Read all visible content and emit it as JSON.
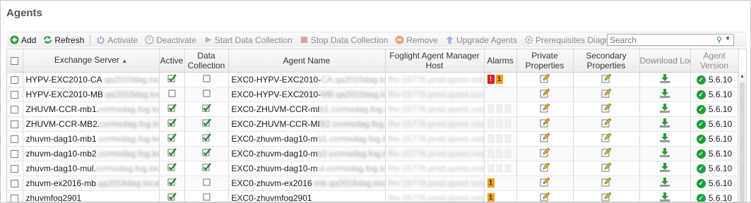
{
  "page": {
    "title": "Agents"
  },
  "toolbar": {
    "add": "Add",
    "refresh": "Refresh",
    "activate": "Activate",
    "deactivate": "Deactivate",
    "start_collection": "Start Data Collection",
    "stop_collection": "Stop Data Collection",
    "remove": "Remove",
    "upgrade": "Upgrade Agents",
    "prereq": "Prerequisites Diagnostic",
    "search_placeholder": "Search"
  },
  "columns": {
    "exchange_server": "Exchange Server",
    "active": "Active",
    "data_collection": "Data Collection",
    "agent_name": "Agent Name",
    "host": "Foglight Agent Manager Host",
    "alarms": "Alarms",
    "private_props": "Private Properties",
    "secondary_props": "Secondary Properties",
    "download_log": "Download Log",
    "agent_version": "Agent Version"
  },
  "colors": {
    "accent_green": "#1f9e3a",
    "alarm_red": "#e21b1b",
    "alarm_orange": "#f39c12"
  },
  "rows": [
    {
      "server": "HYPV-EXC2010-CA",
      "server_blur": ".qa2010dag.local",
      "active": true,
      "collect": false,
      "agent": "EXC0-HYPV-EXC2010-",
      "agent_blur": "CA.qa2010dag.local",
      "host_blur": "fhv-15776.prod.quest.corp",
      "alarms": [
        "red",
        "orange"
      ],
      "alarm_count": "1",
      "version": "5.6.10"
    },
    {
      "server": "HYPV-EXC2010-MB",
      "server_blur": ".qa2010dag.local",
      "active": false,
      "collect": false,
      "agent": "EXC0-HYPV-EXC2010-",
      "agent_blur": "MB.qa2010dag.local",
      "host_blur": "fhv-15776.prod.quest.corp",
      "alarms": [],
      "alarm_count": "",
      "version": "5.6.10"
    },
    {
      "server": "ZHUVM-CCR-mb1.",
      "server_blur": "ccrmxdag.fog.local",
      "active": true,
      "collect": true,
      "agent": "EXC0-ZHUVM-CCR-ml",
      "agent_blur": "b1.ccrmxdag.fog.local",
      "host_blur": "fhv-15776.prod.quest.corp",
      "alarms": [
        "empty",
        "empty",
        "empty"
      ],
      "alarm_count": "",
      "version": "5.6.10"
    },
    {
      "server": "ZHUVM-CCR-MB2.",
      "server_blur": "ccrmxdag.fog.local",
      "active": true,
      "collect": true,
      "agent": "EXC0-ZHUVM-CCR-MI",
      "agent_blur": "B2.ccrmxdag.fog.local",
      "host_blur": "fhv-15776.prod.quest.corp",
      "alarms": [
        "empty",
        "empty",
        "empty"
      ],
      "alarm_count": "",
      "version": "5.6.10"
    },
    {
      "server": "zhuvm-dag10-mb1",
      "server_blur": ".ccrmxdag.fog.local",
      "active": true,
      "collect": true,
      "agent": "EXC0-zhuvm-dag10-m",
      "agent_blur": "b1.ccrmxdag.fog.local",
      "host_blur": "fhv-15776.prod.quest.corp",
      "alarms": [
        "empty",
        "empty",
        "empty"
      ],
      "alarm_count": "",
      "version": "5.6.10"
    },
    {
      "server": "zhuvm-dag10-mb2",
      "server_blur": ".ccrmxdag.fog.local",
      "active": true,
      "collect": true,
      "agent": "EXC0-zhuvm-dag10-m",
      "agent_blur": "b2.ccrmxdag.fog.local",
      "host_blur": "fhv-15776.prod.quest.corp",
      "alarms": [
        "empty",
        "empty",
        "empty"
      ],
      "alarm_count": "",
      "version": "5.6.10"
    },
    {
      "server": "zhuvm-dag10-mul.",
      "server_blur": "ccrmxdag.fog.local",
      "active": true,
      "collect": true,
      "agent": "EXC0-zhuvm-dag10-m",
      "agent_blur": "ul.ccrmxdag.fog.local",
      "host_blur": "fhv-15776.prod.quest.corp",
      "alarms": [
        "empty",
        "empty",
        "empty"
      ],
      "alarm_count": "",
      "version": "5.6.10"
    },
    {
      "server": "zhuvm-ex2016-mb",
      "server_blur": ".qa2016dag.local",
      "active": true,
      "collect": false,
      "agent": "EXC0-zhuvm-ex2016",
      "agent_blur": "-mb.qa2016dag.local",
      "host_blur": "fhv-15776.prod.quest.corp",
      "alarms": [
        "orange"
      ],
      "alarm_count": "1",
      "version": "5.6.10"
    },
    {
      "server": "zhuvmfog2901",
      "server_blur": "",
      "active": true,
      "collect": false,
      "agent": "EXC0-zhuvmfog2901",
      "agent_blur": "",
      "host_blur": "fhv-15776.prod.quest.corp",
      "alarms": [
        "orange"
      ],
      "alarm_count": "1",
      "version": "5.6.10"
    }
  ]
}
